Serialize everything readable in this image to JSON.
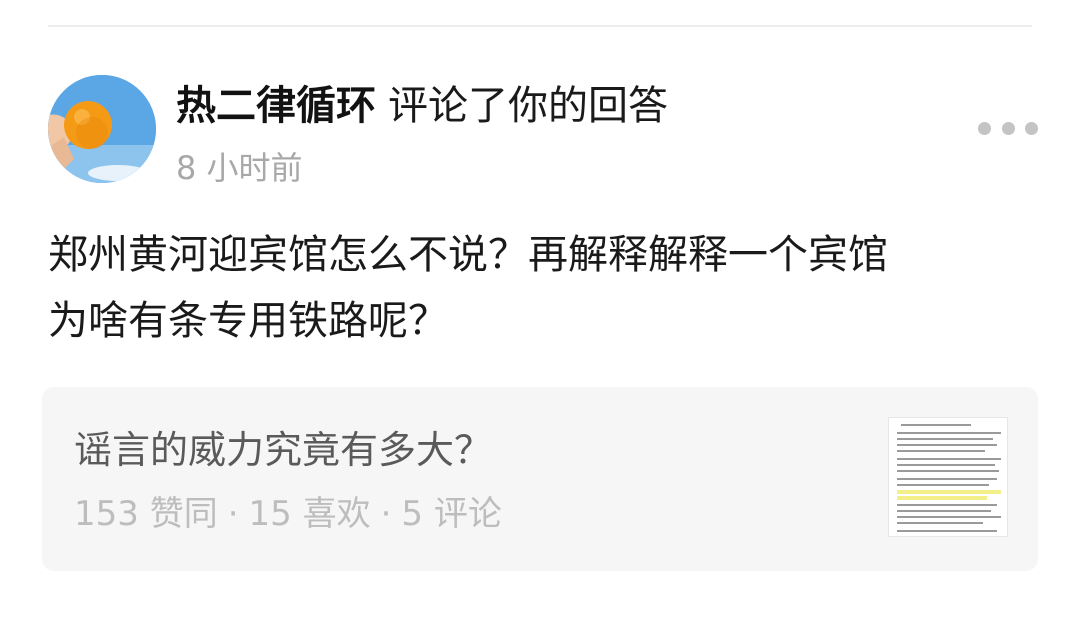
{
  "notification": {
    "author_name": "热二律循环",
    "action_text": "评论了你的回答",
    "timestamp": "8 小时前",
    "avatar_icon": "orange-in-sky-avatar",
    "more_icon": "more-options-icon"
  },
  "comment": {
    "text": "郑州黄河迎宾馆怎么不说？再解释解释一个宾馆\n为啥有条专用铁路呢？"
  },
  "quoted_answer": {
    "title": "谣言的威力究竟有多大？",
    "stats": {
      "likes": "153 赞同",
      "favorites": "15 喜欢",
      "comments": "5 评论",
      "separator": "·"
    },
    "thumbnail_icon": "document-thumbnail"
  }
}
